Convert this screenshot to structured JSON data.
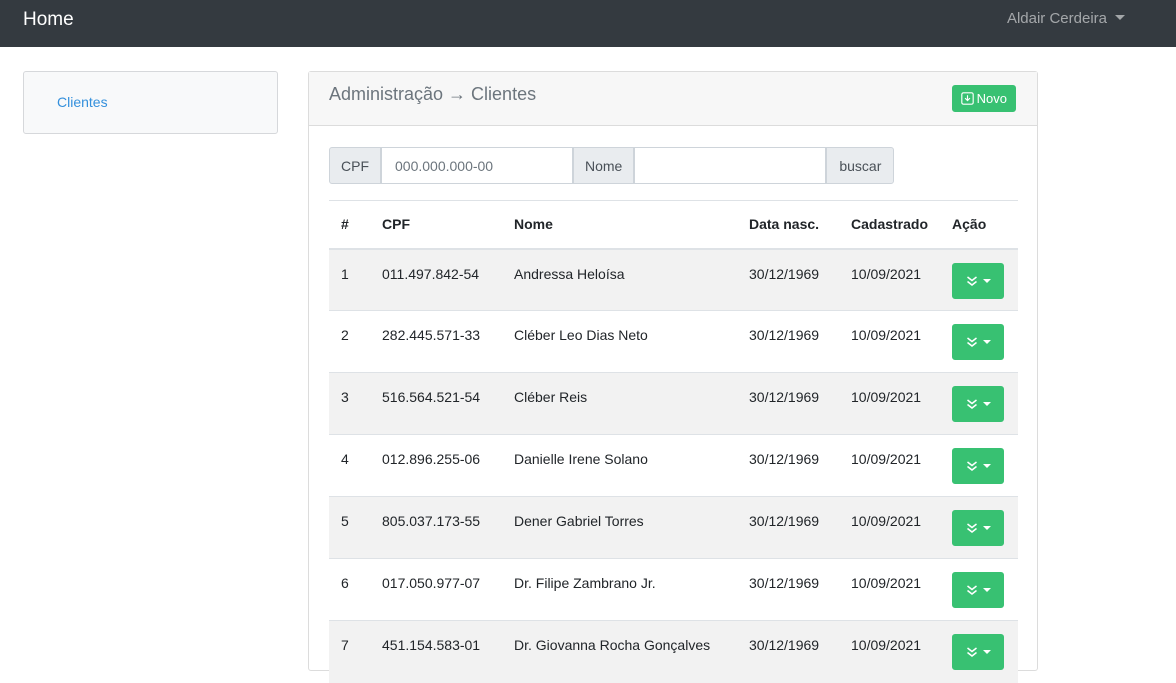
{
  "navbar": {
    "brand": "Home",
    "user_name": "Aldair Cerdeira"
  },
  "sidebar": {
    "items": [
      {
        "label": "Clientes"
      }
    ]
  },
  "card": {
    "title": "Administração → Clientes",
    "new_button_label": "Novo",
    "new_button_icon": "download-box-icon"
  },
  "search": {
    "cpf_label": "CPF",
    "cpf_placeholder": "000.000.000-00",
    "cpf_value": "",
    "name_label": "Nome",
    "name_value": "",
    "search_button_label": "buscar"
  },
  "table": {
    "headers": [
      "#",
      "CPF",
      "Nome",
      "Data nasc.",
      "Cadastrado",
      "Ação"
    ],
    "rows": [
      {
        "num": "1",
        "cpf": "011.497.842-54",
        "nome": "Andressa Heloísa",
        "nasc": "30/12/1969",
        "cadastrado": "10/09/2021"
      },
      {
        "num": "2",
        "cpf": "282.445.571-33",
        "nome": "Cléber Leo Dias Neto",
        "nasc": "30/12/1969",
        "cadastrado": "10/09/2021"
      },
      {
        "num": "3",
        "cpf": "516.564.521-54",
        "nome": "Cléber Reis",
        "nasc": "30/12/1969",
        "cadastrado": "10/09/2021"
      },
      {
        "num": "4",
        "cpf": "012.896.255-06",
        "nome": "Danielle Irene Solano",
        "nasc": "30/12/1969",
        "cadastrado": "10/09/2021"
      },
      {
        "num": "5",
        "cpf": "805.037.173-55",
        "nome": "Dener Gabriel Torres",
        "nasc": "30/12/1969",
        "cadastrado": "10/09/2021"
      },
      {
        "num": "6",
        "cpf": "017.050.977-07",
        "nome": "Dr. Filipe Zambrano Jr.",
        "nasc": "30/12/1969",
        "cadastrado": "10/09/2021"
      },
      {
        "num": "7",
        "cpf": "451.154.583-01",
        "nome": "Dr. Giovanna Rocha Gonçalves",
        "nasc": "30/12/1969",
        "cadastrado": "10/09/2021"
      }
    ],
    "action_icon": "double-chevron-down-icon"
  },
  "colors": {
    "navbar_bg": "#343a40",
    "success": "#38c172",
    "link": "#3490dc",
    "striped_row": "#f2f2f2"
  }
}
